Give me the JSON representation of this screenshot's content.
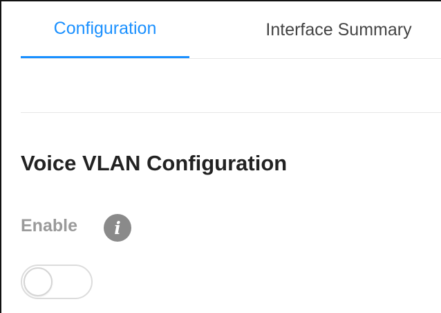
{
  "tabs": [
    {
      "label": "Configuration",
      "active": true
    },
    {
      "label": "Interface Summary",
      "active": false
    }
  ],
  "section": {
    "title": "Voice VLAN Configuration"
  },
  "enable": {
    "label": "Enable",
    "info_icon": "info-icon",
    "info_glyph": "i",
    "toggle_on": false
  },
  "colors": {
    "accent": "#1a90ff",
    "muted_label": "#9a9a9a",
    "info_icon_bg": "#8a8a8a",
    "divider": "#e6e6e6"
  }
}
